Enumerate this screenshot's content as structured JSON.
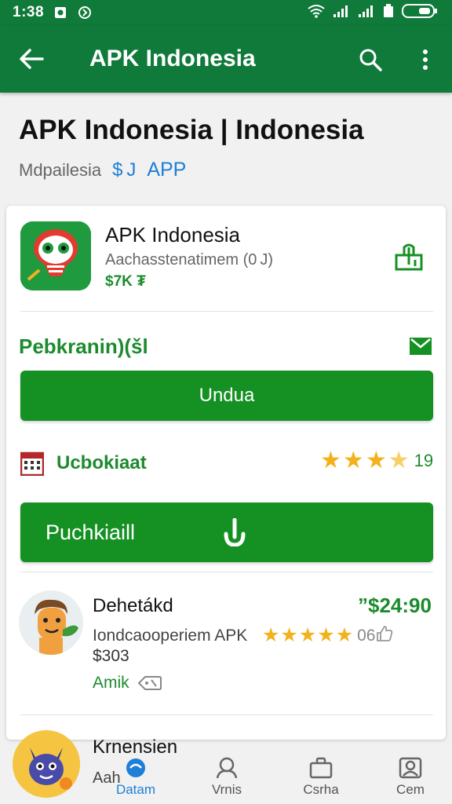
{
  "status_bar": {
    "time": "1:38"
  },
  "app_bar": {
    "title": "APK Indonesia"
  },
  "header": {
    "title": "APK Indonesia | Indonesia",
    "subtitle": "Mdpailesia",
    "price_icon": "$ J",
    "link": "APP"
  },
  "app": {
    "name": "APK Indonesia",
    "developer": "Aachasstenatimem (0 J)",
    "price": "$7K ₮"
  },
  "section": {
    "label": "Pebkranin)(šl"
  },
  "download_button": {
    "label": "Undua"
  },
  "update": {
    "label": "Ucbokiaat",
    "rating": 3.5,
    "rating_count": "19"
  },
  "install_button": {
    "label": "Puchkiaill"
  },
  "review1": {
    "name": "Dehetákd",
    "price": "”$24:90",
    "description": "Iondcaooperiem APK",
    "amount": "$303",
    "stars": 5,
    "count": "06",
    "action": "Amik"
  },
  "review2": {
    "name": "Krnensien",
    "sub": "Aah"
  },
  "bottom_nav": [
    {
      "label": "Datam",
      "icon": "home-icon",
      "active": true
    },
    {
      "label": "Vrnis",
      "icon": "person-icon",
      "active": false
    },
    {
      "label": "Csrha",
      "icon": "bag-icon",
      "active": false
    },
    {
      "label": "Cem",
      "icon": "profile-icon",
      "active": false
    }
  ],
  "colors": {
    "primary": "#0f7a3a",
    "button": "#159124",
    "accent": "#1e7fd6",
    "star": "#f3b21c"
  }
}
